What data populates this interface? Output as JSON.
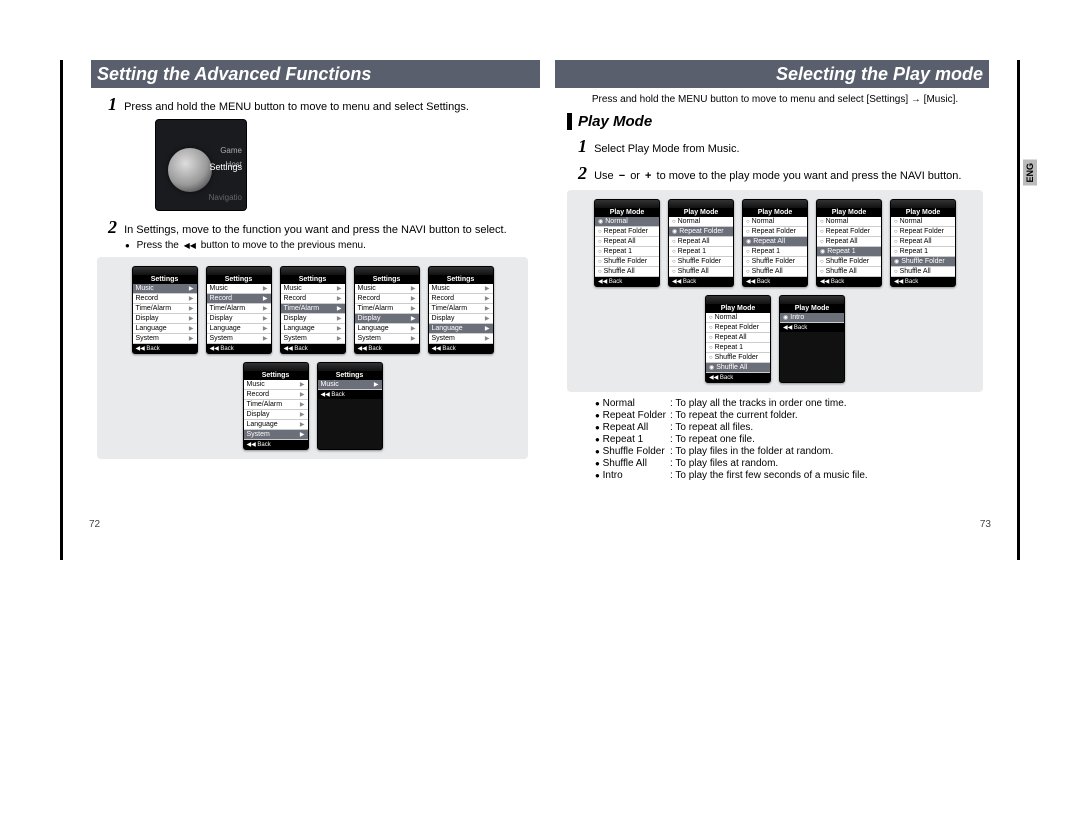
{
  "left": {
    "title": "Setting the Advanced Functions",
    "step1": "Press and hold the MENU button to move to menu and select Settings.",
    "big_label": "Settings",
    "big_menu_items": [
      "Game",
      "Host",
      "Settings",
      "Navigatio"
    ],
    "step2": "In Settings, move to the function you want and press the NAVI button to select.",
    "note2": "Press the ◀◀ button to move to the previous menu.",
    "settings_header": "Settings",
    "settings_items": [
      "Music",
      "Record",
      "Time/Alarm",
      "Display",
      "Language",
      "System"
    ],
    "footer": "◀◀  Back",
    "page": "72"
  },
  "right": {
    "title": "Selecting the Play mode",
    "intro": "Press and hold the MENU button to move to menu and select [Settings] → [Music].",
    "subhead": "Play Mode",
    "step1": "Select Play Mode from Music.",
    "step2_a": "Use",
    "step2_b": "or",
    "step2_c": "to move to the play mode you want and press the NAVI button.",
    "eng": "ENG",
    "pm_header": "Play Mode",
    "pm_items": [
      "Normal",
      "Repeat Folder",
      "Repeat All",
      "Repeat 1",
      "Shuffle Folder",
      "Shuffle All"
    ],
    "last_item": "Intro",
    "footer": "◀◀  Back",
    "legend": [
      {
        "k": "Normal",
        "v": "To play all the tracks in order one time."
      },
      {
        "k": "Repeat Folder",
        "v": "To repeat the current folder."
      },
      {
        "k": "Repeat All",
        "v": "To repeat all files."
      },
      {
        "k": "Repeat 1",
        "v": "To repeat one file."
      },
      {
        "k": "Shuffle Folder",
        "v": "To play files in the folder at random."
      },
      {
        "k": "Shuffle All",
        "v": "To play files at random."
      },
      {
        "k": "Intro",
        "v": "To play the first few seconds of a music file."
      }
    ],
    "page": "73"
  }
}
